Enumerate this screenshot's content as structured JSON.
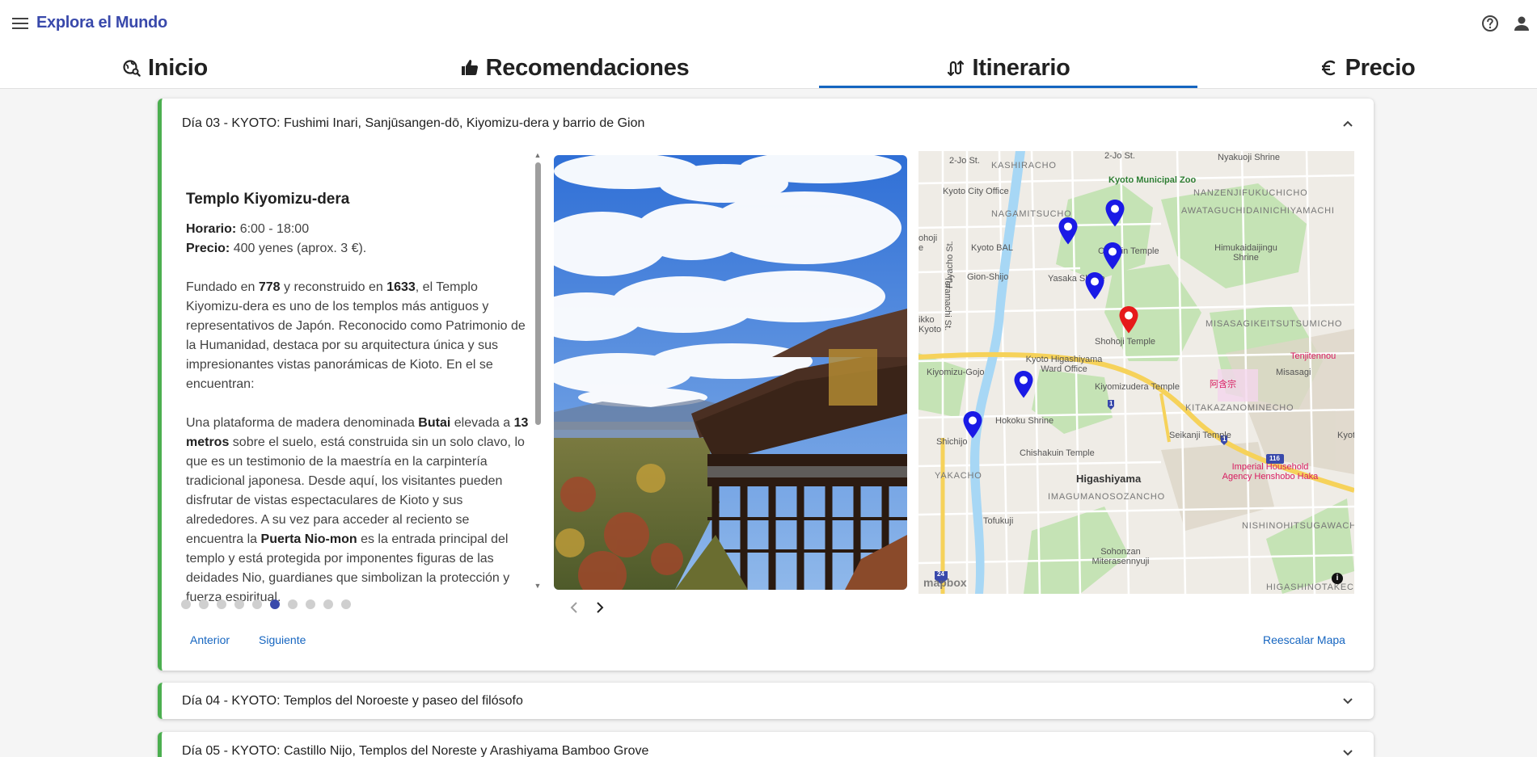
{
  "app": {
    "title": "Explora el Mundo"
  },
  "tabs": [
    {
      "label": "Inicio",
      "icon": "travel-explore-icon"
    },
    {
      "label": "Recomendaciones",
      "icon": "thumb-up-icon"
    },
    {
      "label": "Itinerario",
      "icon": "route-icon",
      "active": true
    },
    {
      "label": "Precio",
      "icon": "euro-icon"
    }
  ],
  "days": [
    {
      "title": "Día 03 - KYOTO: Fushimi Inari, Sanjūsangen-dō, Kiyomizu-dera y barrio de Gion",
      "expanded": true
    },
    {
      "title": "Día 04 - KYOTO: Templos del Noroeste y paseo del filósofo",
      "expanded": false
    },
    {
      "title": "Día 05 - KYOTO: Castillo Nijo, Templos del Noreste y Arashiyama Bamboo Grove",
      "expanded": false
    }
  ],
  "place": {
    "title": "Templo Kiyomizu-dera",
    "schedule_label": "Horario:",
    "schedule_value": "6:00 - 18:00",
    "price_label": "Precio:",
    "price_value": "400 yenes (aprox. 3 €).",
    "p1": {
      "a": "Fundado en ",
      "b": "778",
      "c": " y reconstruido en ",
      "d": "1633",
      "e": ", el Templo Kiyomizu-dera es uno de los templos más antiguos y representativos de Japón. Reconocido como Patrimonio de la Humanidad, destaca por su arquitectura única y sus impresionantes vistas panorámicas de Kioto. En el se encuentran:"
    },
    "p2": {
      "a": "Una plataforma de madera denominada ",
      "b": "Butai",
      "c": " elevada a ",
      "d": "13 metros",
      "e": " sobre el suelo, está construida sin un solo clavo, lo que es un testimonio de la maestría en la carpintería tradicional japonesa. Desde aquí, los visitantes pueden disfrutar de vistas espectaculares de Kioto y sus alrededores. A su vez para acceder al reciento se encuentra la ",
      "f": "Puerta Nio-mon",
      "g": " es la entrada principal del templo y está protegida por imponentes figuras de las deidades Nio, guardianes que simbolizan la protección y fuerza espiritual."
    }
  },
  "carousel": {
    "total": 10,
    "active_index": 5
  },
  "buttons": {
    "prev": "Anterior",
    "next": "Siguiente",
    "rescale": "Reescalar Mapa"
  },
  "map": {
    "attribution": "mapbox",
    "info": "i",
    "labels": {
      "l1": "2-Jo St.",
      "l2": "2-Jo St.",
      "l3": "Nyakuoji Shrine",
      "l4": "KASHIRACHO",
      "l5": "Kyoto Municipal Zoo",
      "l6": "Kyoto City Office",
      "l7": "NANZENJIFUKUCHICHO",
      "l8": "NAGAMITSUCHO",
      "l9": "AWATAGUCHIDAINICHIYAMACHI",
      "l10": "Kyoto BAL",
      "l11": "Himukaidaijingu Shrine",
      "l12": "Chionin Temple",
      "l13": "Gion-Shijo",
      "l14": "Yasaka Shrine",
      "l15": "Teramachi St.",
      "l16": "Fuyacho St.",
      "l17": "MISASAGIKEITSUTSUMICHO",
      "l18": "Shohoji Temple",
      "l19": "Kyoto Higashiyama Ward Office",
      "l20": "Tenjitennou",
      "l21": "Kiyomizu-Gojo",
      "l22": "Misasagi",
      "l23": "阿含宗",
      "l24": "Kiyomizudera Temple",
      "l25": "KITAKAZANOMINECHO",
      "l26": "Hokoku Shrine",
      "l27": "Seikanji Temple",
      "l28": "Shichijo",
      "l29": "Chishakuin Temple",
      "l30": "Higashiyama",
      "l31": "Imperial Household Agency Henshobo Haka",
      "l32": "IMAGUMANOSOZANCHO",
      "l33": "YAKACHO",
      "l34": "Tofukuji",
      "l35": "NISHINOHITSUGAWACHO",
      "l36": "Sohonzan Miterasennyuji",
      "l37": "HIGASHINOTAKECHO",
      "l38": "ikko Kyoto",
      "l39": "ohoji e",
      "l40": "Kyoto I",
      "l41": "116",
      "l42": "24",
      "l43": "1",
      "l44": "1"
    },
    "markers": [
      {
        "color": "#1a1ae6",
        "kind": "blue"
      },
      {
        "color": "#1a1ae6",
        "kind": "blue"
      },
      {
        "color": "#1a1ae6",
        "kind": "blue"
      },
      {
        "color": "#1a1ae6",
        "kind": "blue"
      },
      {
        "color": "#e61a1a",
        "kind": "red"
      },
      {
        "color": "#1a1ae6",
        "kind": "blue"
      },
      {
        "color": "#1a1ae6",
        "kind": "blue"
      }
    ]
  }
}
